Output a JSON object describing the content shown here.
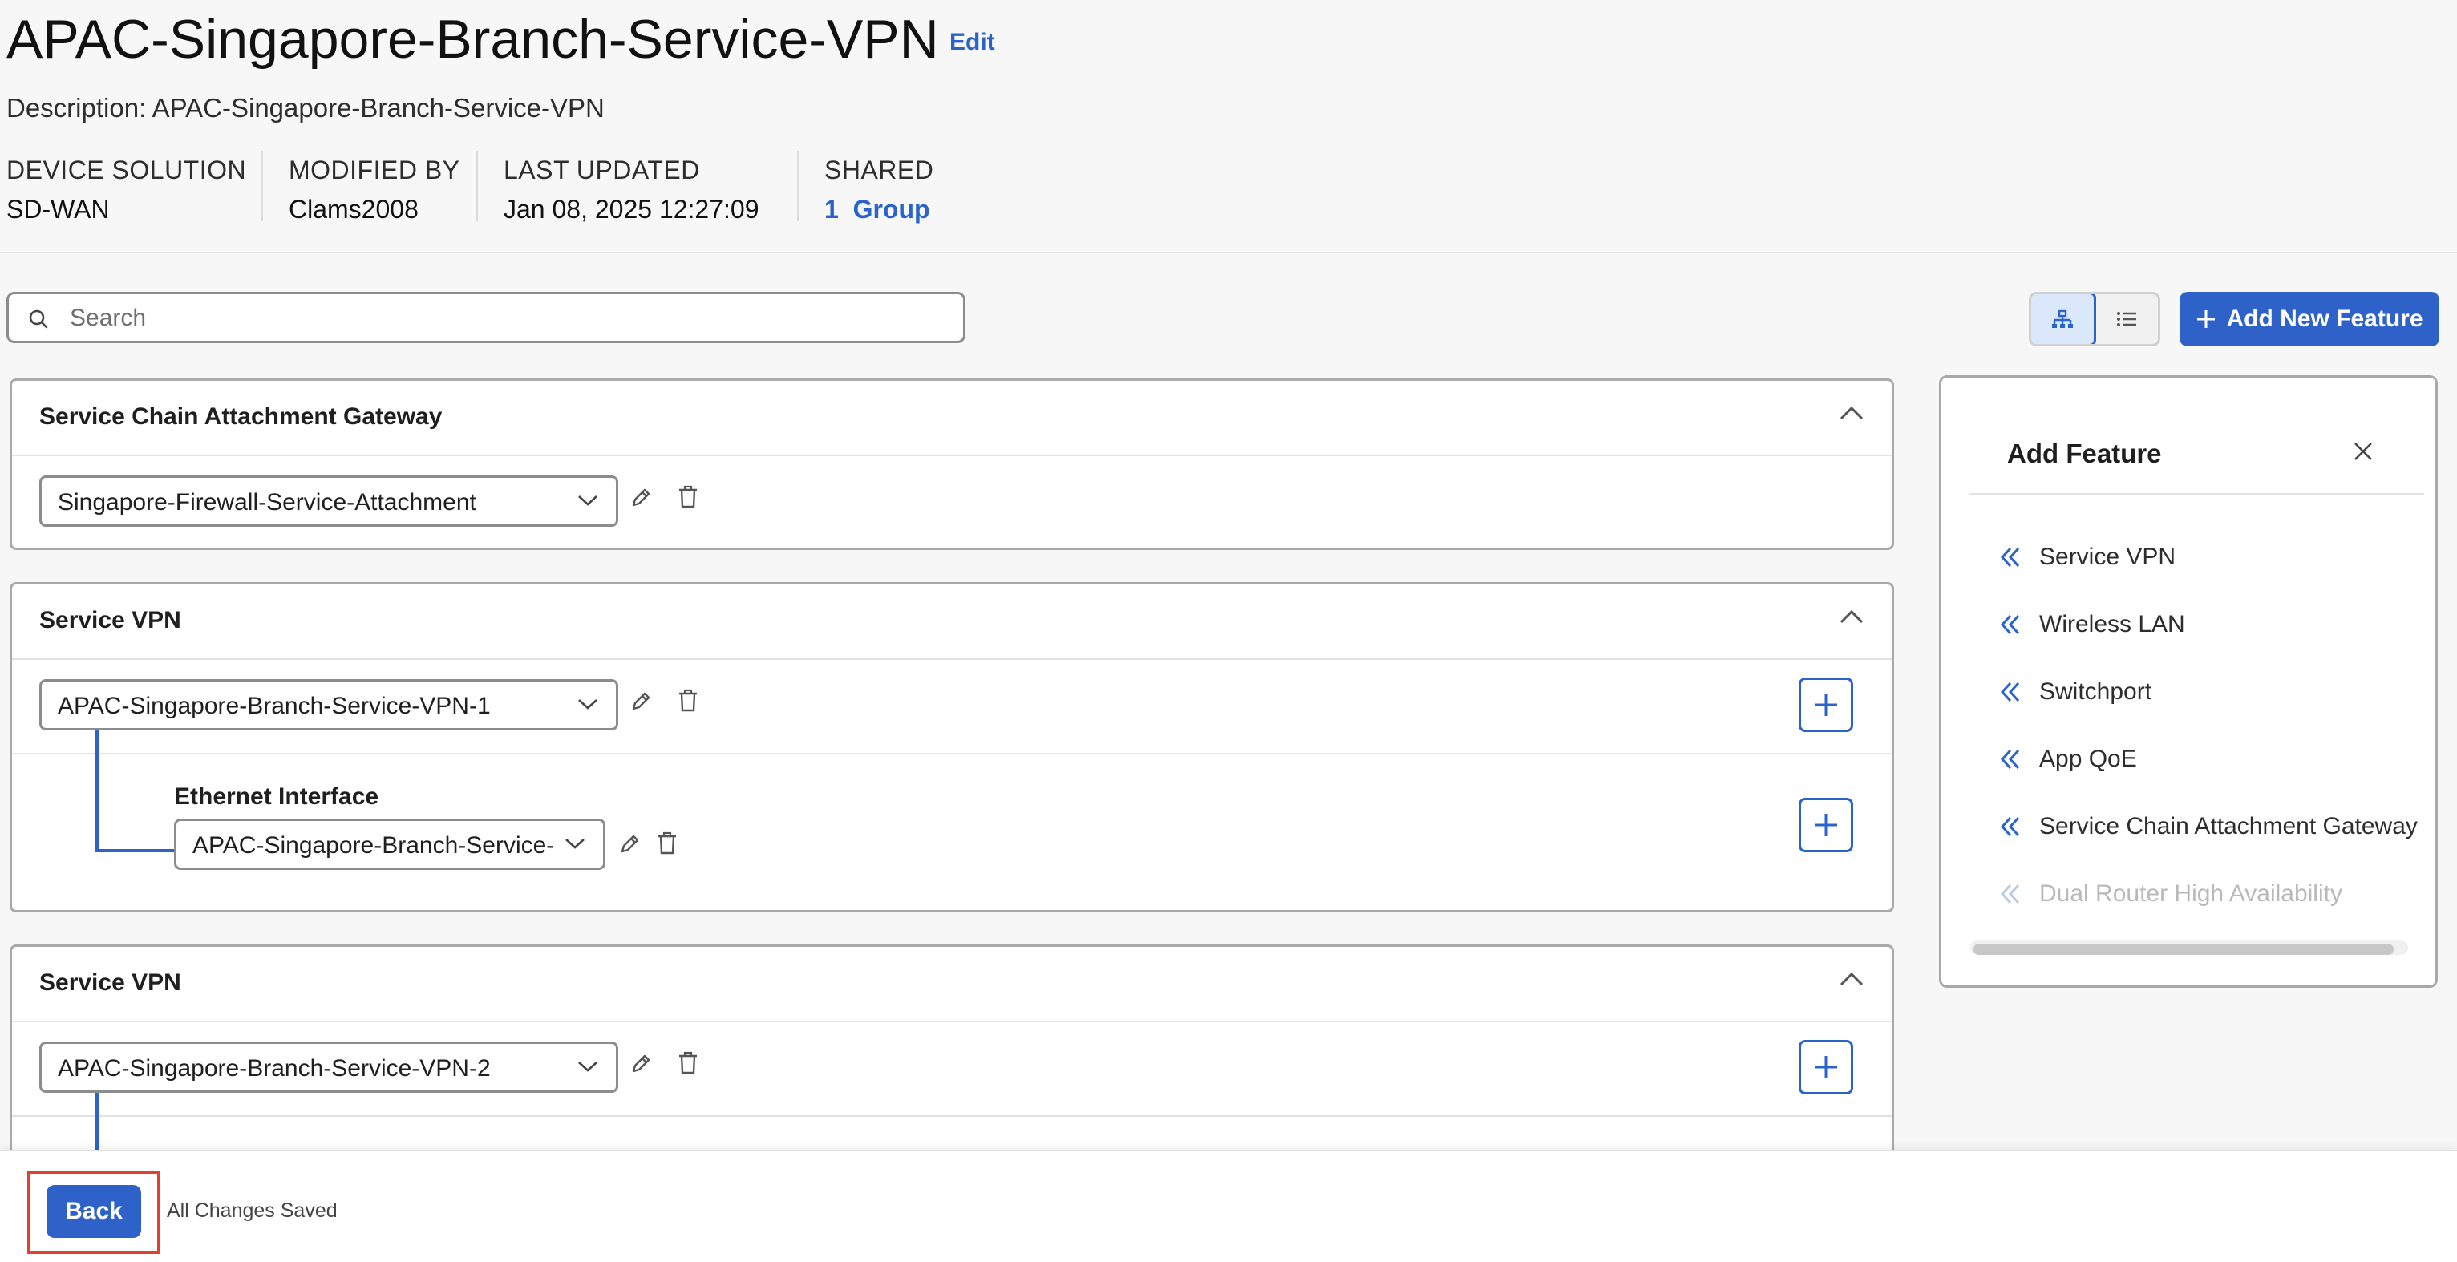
{
  "header": {
    "title": "APAC-Singapore-Branch-Service-VPN",
    "edit_label": "Edit",
    "description": "Description: APAC-Singapore-Branch-Service-VPN",
    "meta": {
      "device_solution_label": "DEVICE SOLUTION",
      "device_solution_value": "SD-WAN",
      "modified_by_label": "MODIFIED BY",
      "modified_by_value": "Clams2008",
      "last_updated_label": "LAST UPDATED",
      "last_updated_value": "Jan 08, 2025 12:27:09",
      "shared_label": "SHARED",
      "shared_value": "1  Group"
    }
  },
  "toolbar": {
    "search_placeholder": "Search",
    "add_new_feature_label": "Add New Feature",
    "active_view": "tree"
  },
  "sections": [
    {
      "title": "Service Chain Attachment Gateway",
      "selected": "Singapore-Firewall-Service-Attachment"
    },
    {
      "title": "Service VPN",
      "selected": "APAC-Singapore-Branch-Service-VPN-1",
      "sub": {
        "title": "Ethernet Interface",
        "selected": "APAC-Singapore-Branch-Service-"
      }
    },
    {
      "title": "Service VPN",
      "selected": "APAC-Singapore-Branch-Service-VPN-2"
    }
  ],
  "feature_panel": {
    "title": "Add Feature",
    "items": [
      {
        "label": "Service VPN",
        "enabled": true
      },
      {
        "label": "Wireless LAN",
        "enabled": true
      },
      {
        "label": "Switchport",
        "enabled": true
      },
      {
        "label": "App QoE",
        "enabled": true
      },
      {
        "label": "Service Chain Attachment Gateway",
        "enabled": true
      },
      {
        "label": "Dual Router High Availability",
        "enabled": false
      }
    ]
  },
  "footer": {
    "back_label": "Back",
    "status": "All Changes Saved"
  },
  "colors": {
    "accent": "#2e62c8",
    "link": "#2b64c9",
    "highlight": "#e2412f",
    "disabled_text": "#b9b9b9"
  }
}
